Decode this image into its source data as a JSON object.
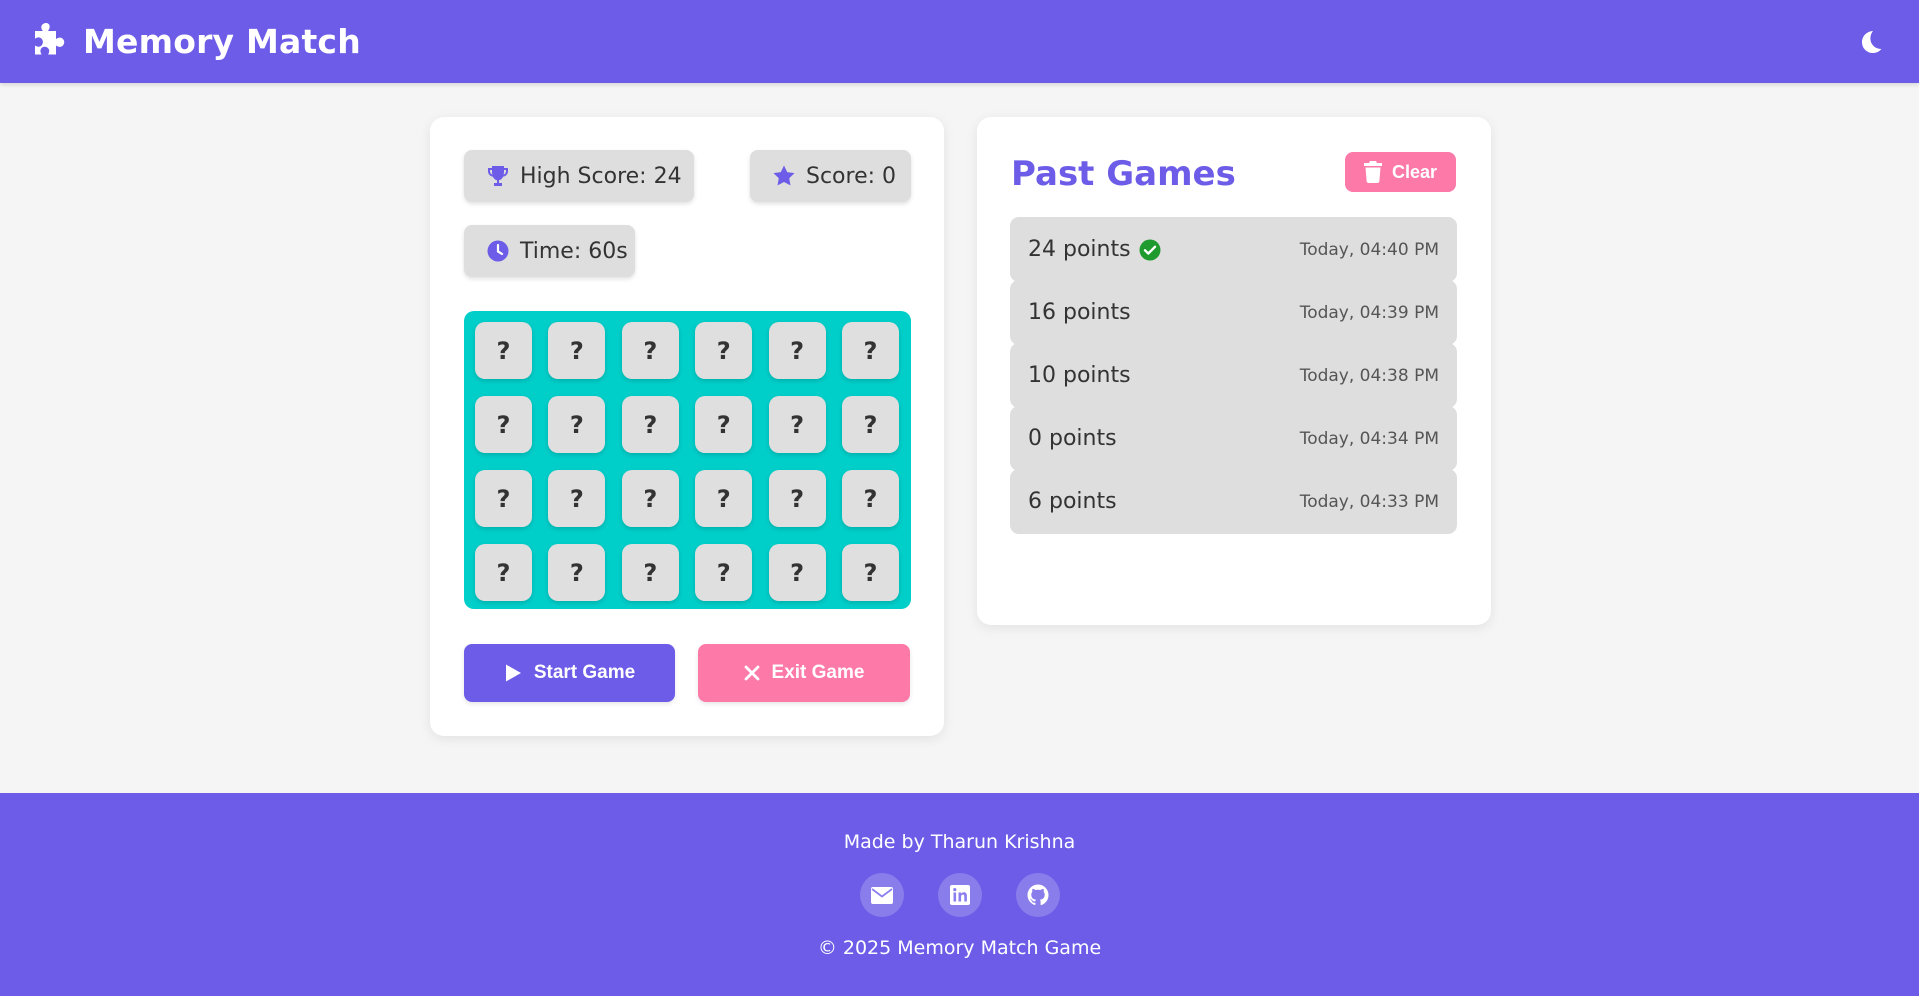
{
  "header": {
    "title": "Memory Match",
    "logo_icon": "puzzle-piece-icon",
    "theme_toggle_icon": "moon-icon"
  },
  "game": {
    "high_score_label": "High Score: 24",
    "score_label": "Score: 0",
    "time_label": "Time: 60s",
    "tile_label": "?",
    "rows": 4,
    "cols": 6,
    "board_color": "#00cec9",
    "start_label": "Start Game",
    "exit_label": "Exit Game"
  },
  "history": {
    "title": "Past Games",
    "clear_label": "Clear",
    "games": [
      {
        "points": "24 points",
        "time": "Today, 04:40 PM",
        "best": true
      },
      {
        "points": "16 points",
        "time": "Today, 04:39 PM",
        "best": false
      },
      {
        "points": "10 points",
        "time": "Today, 04:38 PM",
        "best": false
      },
      {
        "points": "0 points",
        "time": "Today, 04:34 PM",
        "best": false
      },
      {
        "points": "6 points",
        "time": "Today, 04:33 PM",
        "best": false
      }
    ]
  },
  "footer": {
    "made_by": "Made by Tharun Krishna",
    "copyright": "© 2025 Memory Match Game",
    "socials": [
      "email-icon",
      "linkedin-icon",
      "github-icon"
    ]
  },
  "colors": {
    "primary": "#6c5ce7",
    "accent": "#fd79a8",
    "board": "#00cec9",
    "success": "#1e9a2e"
  }
}
